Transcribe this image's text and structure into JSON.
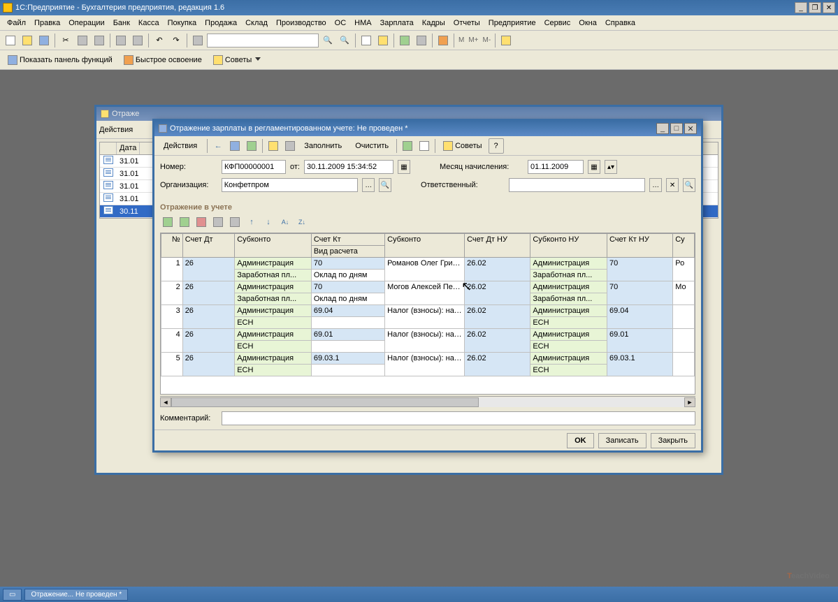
{
  "app": {
    "title": "1С:Предприятие - Бухгалтерия предприятия, редакция 1.6"
  },
  "menu": [
    "Файл",
    "Правка",
    "Операции",
    "Банк",
    "Касса",
    "Покупка",
    "Продажа",
    "Склад",
    "Производство",
    "ОС",
    "НМА",
    "Зарплата",
    "Кадры",
    "Отчеты",
    "Предприятие",
    "Сервис",
    "Окна",
    "Справка"
  ],
  "toolbar2": {
    "show_panel": "Показать панель функций",
    "quick_start": "Быстрое освоение",
    "tips": "Советы"
  },
  "back_window": {
    "title": "Отраже",
    "actions": "Действия",
    "col_date": "Дата",
    "rows": [
      "31.01",
      "31.01",
      "31.01",
      "31.01",
      "30.11"
    ]
  },
  "dialog": {
    "title": "Отражение зарплаты в регламентированном учете: Не проведен *",
    "actions": "Действия",
    "fill": "Заполнить",
    "clear": "Очистить",
    "tips": "Советы",
    "lbl_number": "Номер:",
    "val_number": "КФП00000001",
    "lbl_from": "от:",
    "val_date": "30.11.2009 15:34:52",
    "lbl_month": "Месяц начисления:",
    "val_month": "01.11.2009",
    "lbl_org": "Организация:",
    "val_org": "Конфетпром",
    "lbl_resp": "Ответственный:",
    "section": "Отражение в учете",
    "lbl_comment": "Комментарий:",
    "btn_ok": "OK",
    "btn_save": "Записать",
    "btn_close": "Закрыть",
    "grid": {
      "headers": {
        "num": "№",
        "acc_dt": "Счет Дт",
        "subconto": "Субконто",
        "acc_kt": "Счет Кт",
        "calc_type": "Вид расчета",
        "subconto2": "Субконто",
        "acc_dt_nu": "Счет Дт НУ",
        "subconto_nu": "Субконто НУ",
        "acc_kt_nu": "Счет Кт НУ",
        "su": "Су"
      },
      "rows": [
        {
          "n": "1",
          "dt": "26",
          "sub1a": "Администрация",
          "sub1b": "Заработная пл...",
          "kt": "70",
          "calc": "Оклад по дням",
          "sub2": "Романов Олег Григорьевич",
          "dtnu": "26.02",
          "subnu_a": "Администрация",
          "subnu_b": "Заработная пл...",
          "ktnu": "70",
          "su": "Ро"
        },
        {
          "n": "2",
          "dt": "26",
          "sub1a": "Администрация",
          "sub1b": "Заработная пл...",
          "kt": "70",
          "calc": "Оклад по дням",
          "sub2": "Могов Алексей Петрович",
          "dtnu": "26.02",
          "subnu_a": "Администрация",
          "subnu_b": "Заработная пл...",
          "ktnu": "70",
          "su": "Мо"
        },
        {
          "n": "3",
          "dt": "26",
          "sub1a": "Администрация",
          "sub1b": "ЕСН",
          "kt": "69.04",
          "calc": "",
          "sub2": "Налог (взносы): начислено /",
          "dtnu": "26.02",
          "subnu_a": "Администрация",
          "subnu_b": "ЕСН",
          "ktnu": "69.04",
          "su": ""
        },
        {
          "n": "4",
          "dt": "26",
          "sub1a": "Администрация",
          "sub1b": "ЕСН",
          "kt": "69.01",
          "calc": "",
          "sub2": "Налог (взносы): начислено /",
          "dtnu": "26.02",
          "subnu_a": "Администрация",
          "subnu_b": "ЕСН",
          "ktnu": "69.01",
          "su": ""
        },
        {
          "n": "5",
          "dt": "26",
          "sub1a": "Администрация",
          "sub1b": "ЕСН",
          "kt": "69.03.1",
          "calc": "",
          "sub2": "Налог (взносы): начислено /",
          "dtnu": "26.02",
          "subnu_a": "Администрация",
          "subnu_b": "ЕСН",
          "ktnu": "69.03.1",
          "su": ""
        }
      ]
    }
  },
  "taskbar": {
    "task1": "Отражение... Не проведен *"
  },
  "watermark": "eachVideo"
}
